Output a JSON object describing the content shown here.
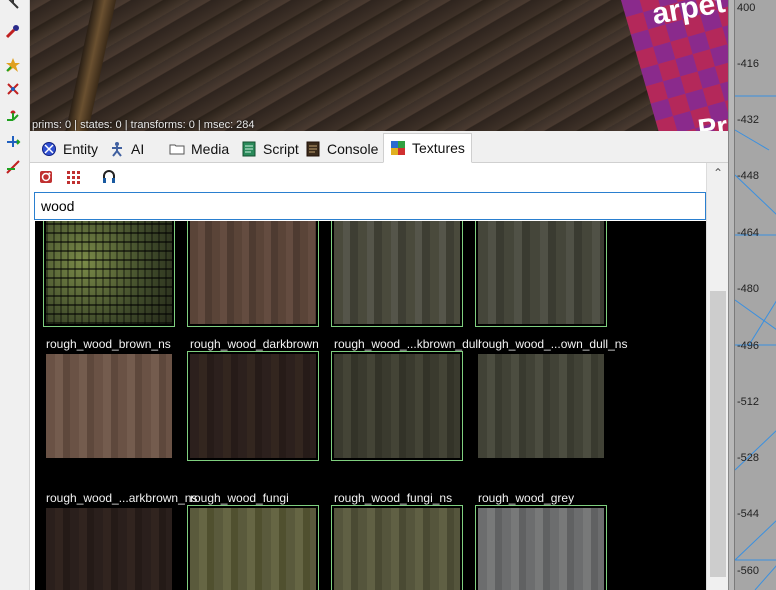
{
  "viewport": {
    "stats": "prims: 0 | states: 0 | transforms: 0 | msec: 284",
    "checker_text_top": "arpet",
    "checker_text_bottom": "Pr"
  },
  "left_toolbar": {
    "tools": [
      {
        "name": "move-tool-icon"
      },
      {
        "name": "paint-tool-icon"
      },
      {
        "name": "spawn-tool-icon"
      },
      {
        "name": "skeleton-tool-icon"
      },
      {
        "name": "translate-tool-icon"
      },
      {
        "name": "rotate-tool-icon"
      },
      {
        "name": "scale-tool-icon"
      }
    ]
  },
  "right_panel": {
    "ruler_labels": [
      "400",
      "-416",
      "-432",
      "-448",
      "-464",
      "-480",
      "-496",
      "-512",
      "-528",
      "-544",
      "-560"
    ]
  },
  "tabs": [
    {
      "label": "Entity",
      "icon": "entity-icon",
      "active": false
    },
    {
      "label": "AI",
      "icon": "ai-icon",
      "active": false
    },
    {
      "label": "Media",
      "icon": "folder-icon",
      "active": false
    },
    {
      "label": "Script",
      "icon": "script-icon",
      "active": false
    },
    {
      "label": "Console",
      "icon": "console-icon",
      "active": false
    },
    {
      "label": "Textures",
      "icon": "textures-icon",
      "active": true
    }
  ],
  "panel_toolbar": {
    "tools": [
      "refresh-textures-icon",
      "grid-view-icon",
      "headphones-icon"
    ]
  },
  "search": {
    "value": "wood",
    "placeholder": ""
  },
  "textures": [
    {
      "label": "rough_wood_brown_ns",
      "fill": "brown-ns"
    },
    {
      "label": "rough_wood_darkbrown",
      "fill": "darkbrown"
    },
    {
      "label": "rough_wood_...kbrown_dull",
      "fill": "kbrown-dull"
    },
    {
      "label": "rough_wood_...own_dull_ns",
      "fill": "own-dull-ns"
    },
    {
      "label": "rough_wood_...arkbrown_ns",
      "fill": "arkbrown-ns"
    },
    {
      "label": "rough_wood_fungi",
      "fill": "fungi"
    },
    {
      "label": "rough_wood_fungi_ns",
      "fill": "fungi-ns"
    },
    {
      "label": "rough_wood_grey",
      "fill": "grey"
    },
    {
      "label": "",
      "fill": "r3c1"
    },
    {
      "label": "",
      "fill": "r3c2"
    },
    {
      "label": "",
      "fill": "r3c3"
    },
    {
      "label": "",
      "fill": "r3c4"
    }
  ],
  "colors": {
    "selection_border": "#7fcf7f",
    "search_focus": "#2a7fcf",
    "grid_background": "#000000"
  }
}
